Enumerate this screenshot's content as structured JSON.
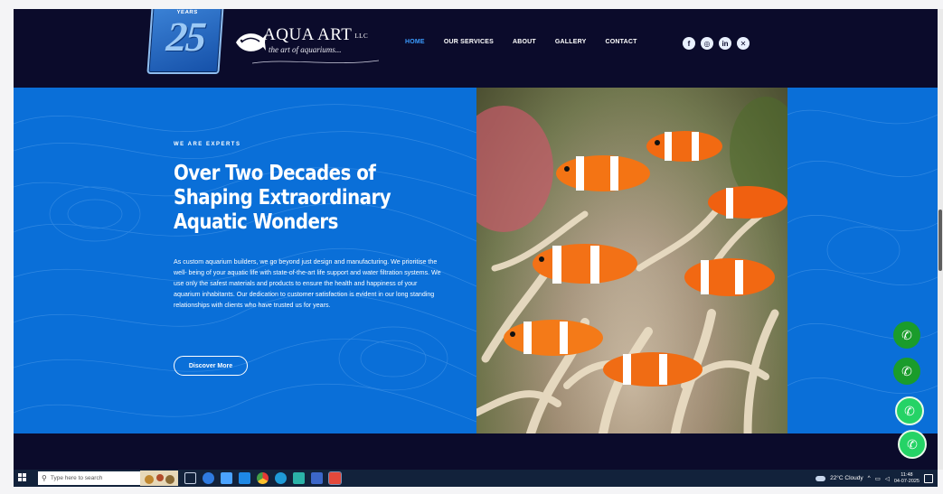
{
  "header": {
    "badge": {
      "years_text": "YEARS",
      "number": "25"
    },
    "logo": {
      "name": "AQUA ART",
      "suffix": "LLC",
      "tagline": "the art of aquariums..."
    },
    "nav": [
      {
        "label": "HOME",
        "active": true
      },
      {
        "label": "OUR SERVICES",
        "active": false
      },
      {
        "label": "ABOUT",
        "active": false
      },
      {
        "label": "GALLERY",
        "active": false
      },
      {
        "label": "CONTACT",
        "active": false
      }
    ],
    "social": [
      "facebook-icon",
      "instagram-icon",
      "linkedin-icon",
      "x-icon"
    ]
  },
  "hero": {
    "eyebrow": "WE ARE EXPERTS",
    "headline": "Over Two Decades of Shaping Extraordinary Aquatic Wonders",
    "body": "As custom aquarium builders, we go beyond just design and manufacturing. We prioritise the well- being of your aquatic life with state-of-the-art life support and water filtration systems. We use only the safest materials and products to ensure the health and happiness of your aquarium inhabitants. Our dedication to customer satisfaction is evident in our long standing relationships with clients who have trusted us for years.",
    "cta_label": "Discover More",
    "background_color": "#0a6fd8",
    "nav_active_color": "#3b9cff"
  },
  "floating_buttons": [
    "phone-icon",
    "phone-icon",
    "whatsapp-icon",
    "whatsapp-icon"
  ],
  "taskbar": {
    "search_placeholder": "Type here to search",
    "weather": "22°C  Cloudy",
    "time": "11:48",
    "date": "04-07-2025"
  }
}
